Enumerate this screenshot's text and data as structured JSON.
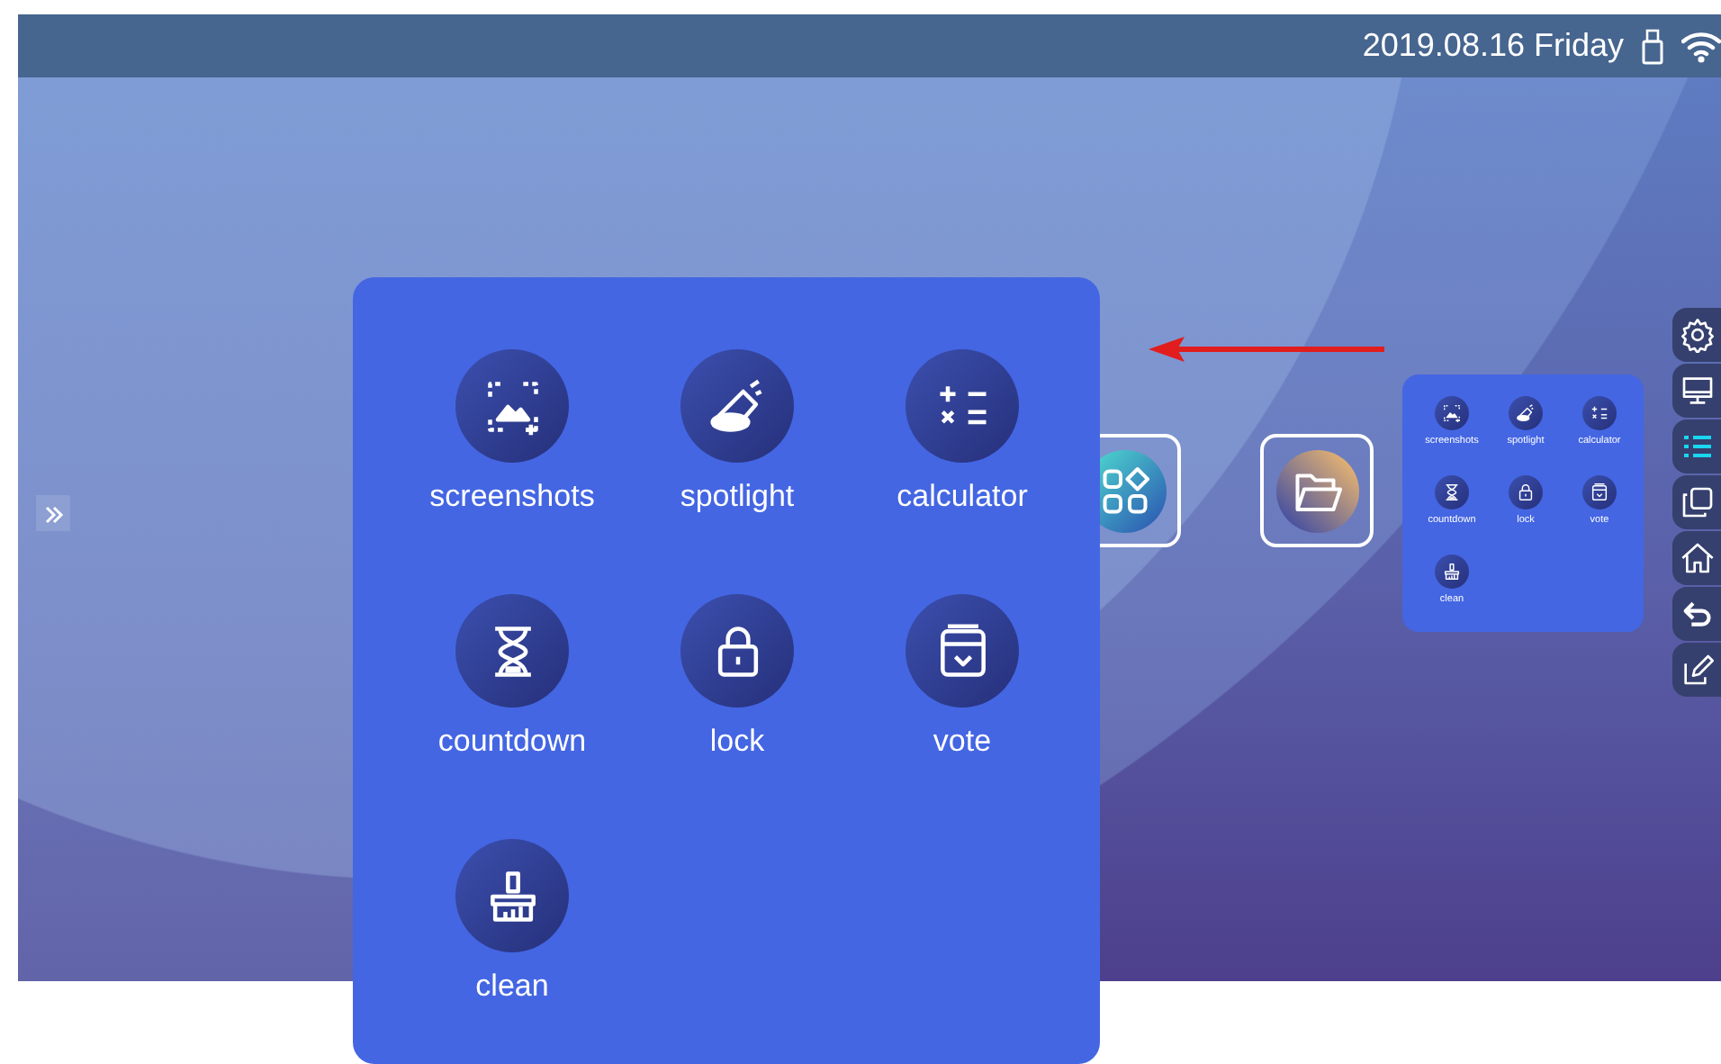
{
  "status_bar": {
    "date": "2019.08.16 Friday"
  },
  "tool_panel": {
    "tools": [
      {
        "kind": "screenshot",
        "label": "screenshots"
      },
      {
        "kind": "spotlight",
        "label": "spotlight"
      },
      {
        "kind": "calculator",
        "label": "calculator"
      },
      {
        "kind": "countdown",
        "label": "countdown"
      },
      {
        "kind": "lock",
        "label": "lock"
      },
      {
        "kind": "vote",
        "label": "vote"
      },
      {
        "kind": "clean",
        "label": "clean"
      }
    ]
  },
  "mini_panel": {
    "tools": [
      {
        "kind": "screenshot",
        "label": "screenshots"
      },
      {
        "kind": "spotlight",
        "label": "spotlight"
      },
      {
        "kind": "calculator",
        "label": "calculator"
      },
      {
        "kind": "countdown",
        "label": "countdown"
      },
      {
        "kind": "lock",
        "label": "lock"
      },
      {
        "kind": "vote",
        "label": "vote"
      },
      {
        "kind": "clean",
        "label": "clean"
      }
    ]
  },
  "desktop_apps": [
    {
      "kind": "apps"
    },
    {
      "kind": "folder"
    }
  ],
  "side_toolbar": [
    {
      "kind": "settings",
      "selected": false
    },
    {
      "kind": "monitor",
      "selected": false
    },
    {
      "kind": "list",
      "selected": true
    },
    {
      "kind": "copy",
      "selected": false
    },
    {
      "kind": "home",
      "selected": false
    },
    {
      "kind": "back",
      "selected": false
    },
    {
      "kind": "edit",
      "selected": false
    }
  ]
}
